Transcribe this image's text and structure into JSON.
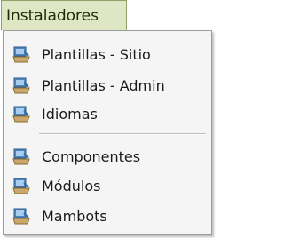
{
  "menu": {
    "title": "Instaladores",
    "items": [
      {
        "label": "Plantillas - Sitio",
        "icon": "installer-icon"
      },
      {
        "label": "Plantillas - Admin",
        "icon": "installer-icon"
      },
      {
        "label": "Idiomas",
        "icon": "installer-icon"
      },
      {
        "label": "Componentes",
        "icon": "installer-icon"
      },
      {
        "label": "Módulos",
        "icon": "installer-icon"
      },
      {
        "label": "Mambots",
        "icon": "installer-icon"
      }
    ]
  },
  "colors": {
    "tab_bg": "#dfe6c3",
    "tab_border": "#8fa16a",
    "dropdown_bg": "#f5f5f5",
    "icon_blue": "#3f79b4",
    "icon_tan": "#caa76a"
  }
}
